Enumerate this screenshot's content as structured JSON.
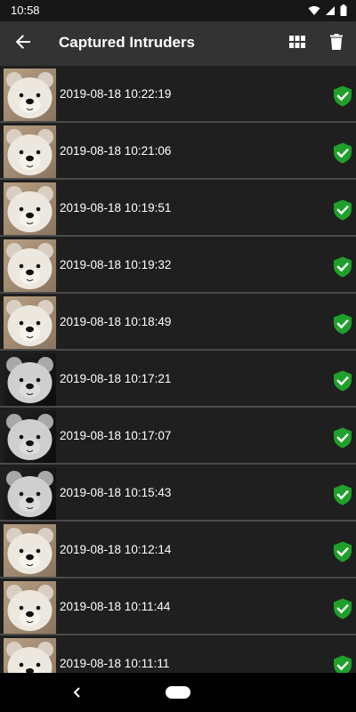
{
  "status_bar": {
    "time": "10:58"
  },
  "app_bar": {
    "title": "Captured Intruders",
    "back_icon": "arrow-left-icon",
    "grid_icon": "grid-view-icon",
    "delete_icon": "trash-icon"
  },
  "list": {
    "items": [
      {
        "timestamp": "2019-08-18 10:22:19",
        "thumb_style": "warm",
        "status_icon": "shield-check-icon"
      },
      {
        "timestamp": "2019-08-18 10:21:06",
        "thumb_style": "warm",
        "status_icon": "shield-check-icon"
      },
      {
        "timestamp": "2019-08-18 10:19:51",
        "thumb_style": "warm",
        "status_icon": "shield-check-icon"
      },
      {
        "timestamp": "2019-08-18 10:19:32",
        "thumb_style": "warm",
        "status_icon": "shield-check-icon"
      },
      {
        "timestamp": "2019-08-18 10:18:49",
        "thumb_style": "warm",
        "status_icon": "shield-check-icon"
      },
      {
        "timestamp": "2019-08-18 10:17:21",
        "thumb_style": "gray",
        "status_icon": "shield-check-icon"
      },
      {
        "timestamp": "2019-08-18 10:17:07",
        "thumb_style": "gray",
        "status_icon": "shield-check-icon"
      },
      {
        "timestamp": "2019-08-18 10:15:43",
        "thumb_style": "gray",
        "status_icon": "shield-check-icon"
      },
      {
        "timestamp": "2019-08-18 10:12:14",
        "thumb_style": "warm",
        "status_icon": "shield-check-icon"
      },
      {
        "timestamp": "2019-08-18 10:11:44",
        "thumb_style": "warm",
        "status_icon": "shield-check-icon"
      },
      {
        "timestamp": "2019-08-18 10:11:11",
        "thumb_style": "warm",
        "status_icon": "shield-check-icon"
      }
    ]
  },
  "colors": {
    "app_bar": "#333333",
    "list_bg": "#1f1f1f",
    "divider": "#4a4a4a",
    "shield_green": "#1fa02a",
    "nav_bar": "#000000"
  }
}
